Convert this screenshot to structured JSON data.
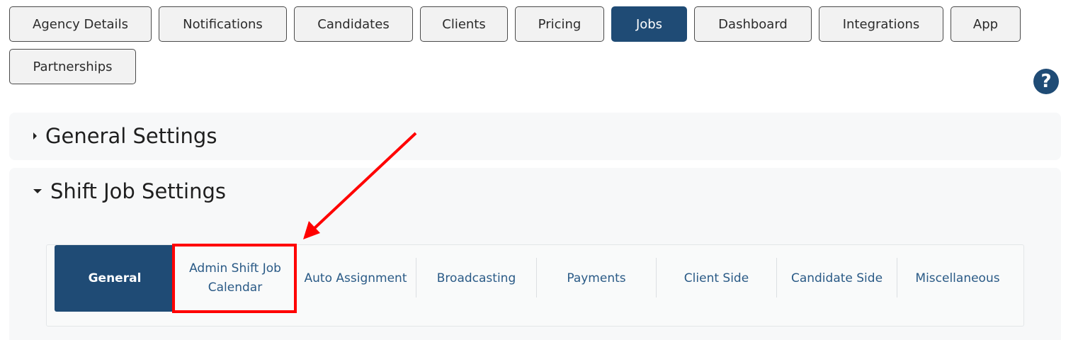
{
  "top_tabs": [
    {
      "label": "Agency Details",
      "active": false
    },
    {
      "label": "Notifications",
      "active": false
    },
    {
      "label": "Candidates",
      "active": false
    },
    {
      "label": "Clients",
      "active": false
    },
    {
      "label": "Pricing",
      "active": false
    },
    {
      "label": "Jobs",
      "active": true
    },
    {
      "label": "Dashboard",
      "active": false
    },
    {
      "label": "Integrations",
      "active": false
    },
    {
      "label": "App",
      "active": false
    },
    {
      "label": "Partnerships",
      "active": false
    }
  ],
  "help": {
    "glyph": "?"
  },
  "sections": {
    "general_settings": {
      "title": "General Settings",
      "expanded": false
    },
    "shift_job_settings": {
      "title": "Shift Job Settings",
      "expanded": true
    }
  },
  "shift_tabs": [
    {
      "label": "General",
      "active": true
    },
    {
      "label": "Admin Shift Job Calendar",
      "active": false
    },
    {
      "label": "Auto Assignment",
      "active": false
    },
    {
      "label": "Broadcasting",
      "active": false
    },
    {
      "label": "Payments",
      "active": false
    },
    {
      "label": "Client Side",
      "active": false
    },
    {
      "label": "Candidate Side",
      "active": false
    },
    {
      "label": "Miscellaneous",
      "active": false
    }
  ],
  "annotation": {
    "color": "#ff0000"
  },
  "colors": {
    "accent": "#1f4b75",
    "link": "#2a5a86"
  }
}
